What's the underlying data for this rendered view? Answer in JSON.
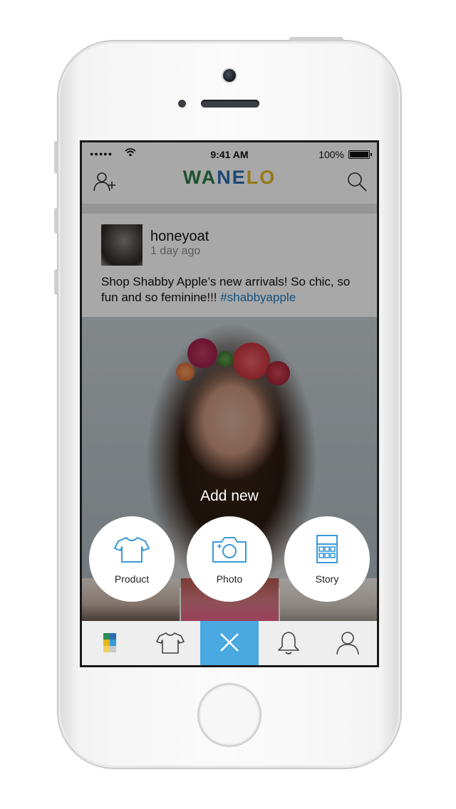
{
  "status_bar": {
    "signal": "●●●●●",
    "time": "9:41 AM",
    "battery": "100%"
  },
  "header": {
    "logo_letters": [
      "W",
      "A",
      "N",
      "E",
      "L",
      "O"
    ],
    "icons": [
      "add-user-icon",
      "search-icon"
    ]
  },
  "post": {
    "username": "honeyoat",
    "time_ago": "1 day ago",
    "caption": "Shop Shabby Apple’s new arrivals! So chic, so fun and so feminine!!! ",
    "hashtag": "#shabbyapple"
  },
  "add_menu": {
    "title": "Add new",
    "options": [
      {
        "label": "Product",
        "icon": "tshirt-icon"
      },
      {
        "label": "Photo",
        "icon": "camera-icon"
      },
      {
        "label": "Story",
        "icon": "grid-icon"
      }
    ]
  },
  "tab_bar": {
    "tabs": [
      "collections-icon",
      "tshirt-icon",
      "close-icon",
      "bell-icon",
      "profile-icon"
    ]
  },
  "colors": {
    "accent": "#4aa9e0",
    "logo_green": "#2c7a46",
    "logo_blue": "#2a6fb0",
    "logo_yellow": "#e2b820",
    "hashtag": "#1d7cc0",
    "icon_blue": "#3a9ad9"
  }
}
